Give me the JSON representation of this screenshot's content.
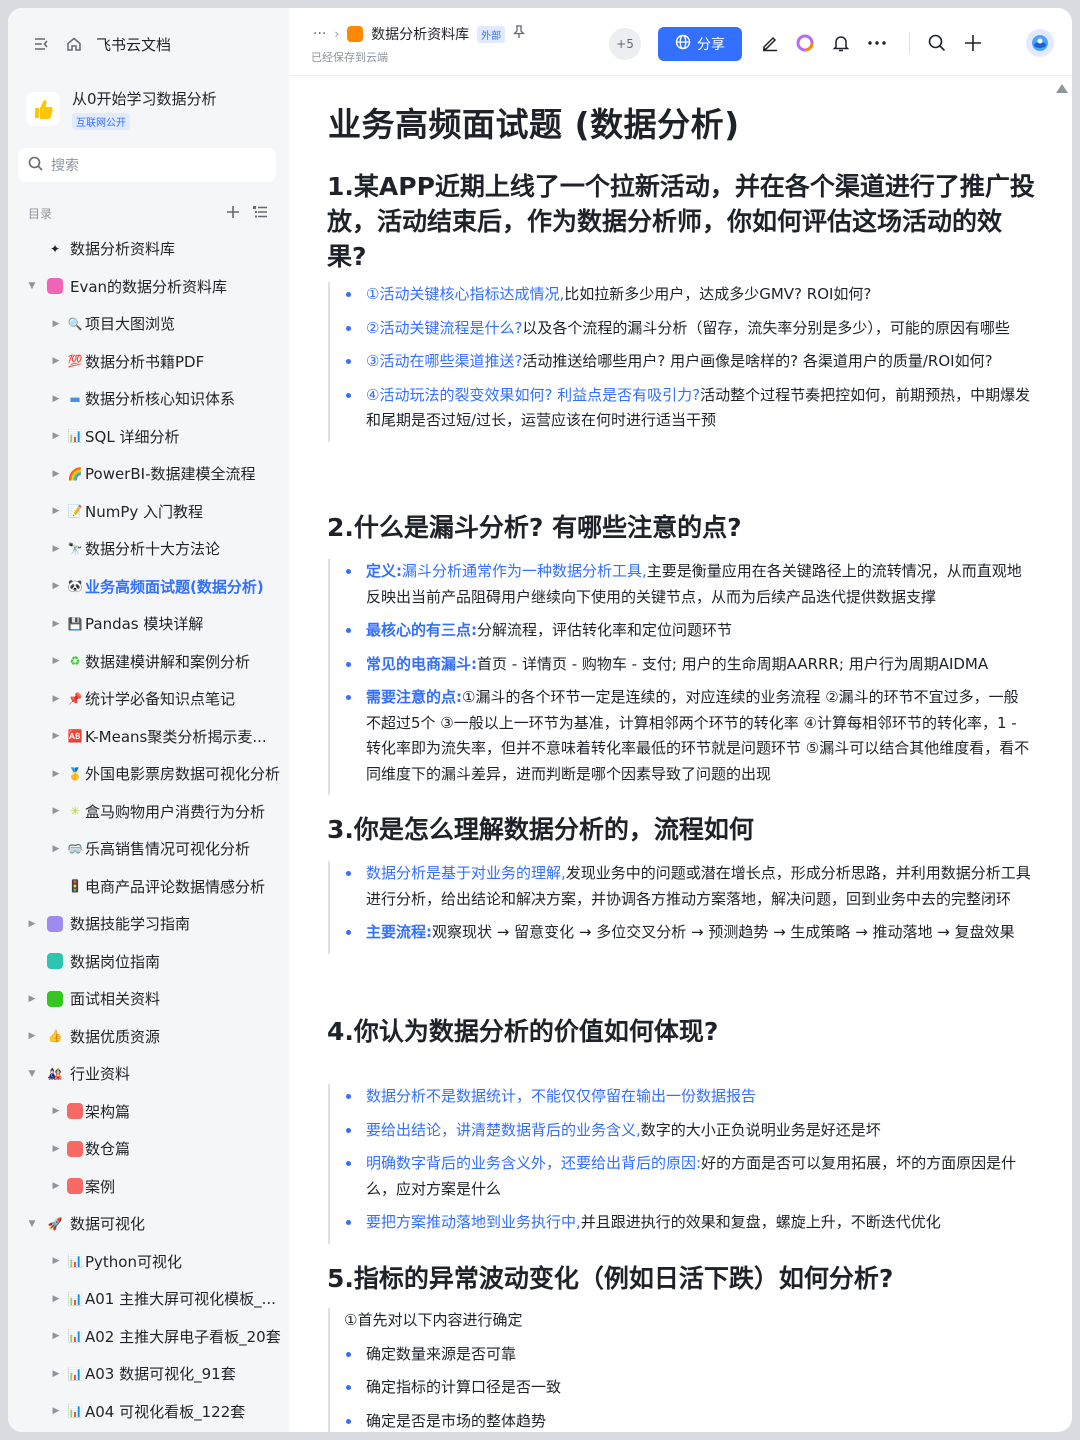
{
  "app": {
    "name": "飞书云文档"
  },
  "space": {
    "name": "从0开始学习数据分析",
    "badge": "互联网公开"
  },
  "search": {
    "placeholder": "搜索"
  },
  "toc": {
    "label": "目录"
  },
  "tree": [
    {
      "label": "数据分析资料库",
      "level": 0,
      "arrow": "",
      "icon": "✦",
      "iconColor": "#1f2329"
    },
    {
      "label": "Evan的数据分析资料库",
      "level": 0,
      "arrow": "▼",
      "icon": "sq",
      "iconColor": "#f065b8"
    },
    {
      "label": "项目大图浏览",
      "level": 1,
      "arrow": "▶",
      "icon": "🔍",
      "iconColor": "#3370ff"
    },
    {
      "label": "数据分析书籍PDF",
      "level": 1,
      "arrow": "▶",
      "icon": "💯",
      "iconColor": "#f54a45"
    },
    {
      "label": "数据分析核心知识体系",
      "level": 1,
      "arrow": "▶",
      "icon": "▬",
      "iconColor": "#4a90e2"
    },
    {
      "label": "SQL 详细分析",
      "level": 1,
      "arrow": "▶",
      "icon": "📊",
      "iconColor": "#3370ff"
    },
    {
      "label": "PowerBI-数据建模全流程",
      "level": 1,
      "arrow": "▶",
      "icon": "🌈",
      "iconColor": "#ff8800"
    },
    {
      "label": "NumPy 入门教程",
      "level": 1,
      "arrow": "▶",
      "icon": "📝",
      "iconColor": "#f54a45"
    },
    {
      "label": "数据分析十大方法论",
      "level": 1,
      "arrow": "▶",
      "icon": "🔭",
      "iconColor": "#5b6bd5"
    },
    {
      "label": "业务高频面试题(数据分析)",
      "level": 1,
      "arrow": "▶",
      "icon": "🐼",
      "iconColor": "#1f2329",
      "active": true
    },
    {
      "label": "Pandas 模块详解",
      "level": 1,
      "arrow": "▶",
      "icon": "💾",
      "iconColor": "#5b6bd5"
    },
    {
      "label": "数据建模讲解和案例分析",
      "level": 1,
      "arrow": "▶",
      "icon": "♻",
      "iconColor": "#34c724"
    },
    {
      "label": "统计学必备知识点笔记",
      "level": 1,
      "arrow": "▶",
      "icon": "📌",
      "iconColor": "#f54a45"
    },
    {
      "label": "K-Means聚类分析揭示麦...",
      "level": 1,
      "arrow": "▶",
      "icon": "🆎",
      "iconColor": "#f54a45"
    },
    {
      "label": "外国电影票房数据可视化分析",
      "level": 1,
      "arrow": "▶",
      "icon": "🥇",
      "iconColor": "#ffc60a"
    },
    {
      "label": "盒马购物用户消费行为分析",
      "level": 1,
      "arrow": "▶",
      "icon": "✳",
      "iconColor": "#b5d334"
    },
    {
      "label": "乐高销售情况可视化分析",
      "level": 1,
      "arrow": "▶",
      "icon": "🥽",
      "iconColor": "#5b6bd5"
    },
    {
      "label": "电商产品评论数据情感分析",
      "level": 1,
      "arrow": "",
      "icon": "🚦",
      "iconColor": "#34c724"
    },
    {
      "label": "数据技能学习指南",
      "level": 0,
      "arrow": "▶",
      "icon": "sq",
      "iconColor": "#9f8bf0"
    },
    {
      "label": "数据岗位指南",
      "level": 0,
      "arrow": "",
      "icon": "sq",
      "iconColor": "#2dc4b2"
    },
    {
      "label": "面试相关资料",
      "level": 0,
      "arrow": "▶",
      "icon": "sq",
      "iconColor": "#34c724"
    },
    {
      "label": "数据优质资源",
      "level": 0,
      "arrow": "▶",
      "icon": "👍",
      "iconColor": "#ffc60a"
    },
    {
      "label": "行业资料",
      "level": 0,
      "arrow": "▼",
      "icon": "🎎",
      "iconColor": "#f54a45"
    },
    {
      "label": "架构篇",
      "level": 1,
      "arrow": "▶",
      "icon": "sq",
      "iconColor": "#f76964"
    },
    {
      "label": "数仓篇",
      "level": 1,
      "arrow": "▶",
      "icon": "sq",
      "iconColor": "#f76964"
    },
    {
      "label": "案例",
      "level": 1,
      "arrow": "▶",
      "icon": "sq",
      "iconColor": "#f76964"
    },
    {
      "label": "数据可视化",
      "level": 0,
      "arrow": "▼",
      "icon": "🚀",
      "iconColor": "#f54a45"
    },
    {
      "label": "Python可视化",
      "level": 1,
      "arrow": "▶",
      "icon": "📊",
      "iconColor": "#3370ff"
    },
    {
      "label": "A01 主推大屏可视化模板_...",
      "level": 1,
      "arrow": "▶",
      "icon": "📊",
      "iconColor": "#3370ff"
    },
    {
      "label": "A02 主推大屏电子看板_20套",
      "level": 1,
      "arrow": "▶",
      "icon": "📊",
      "iconColor": "#3370ff"
    },
    {
      "label": "A03 数据可视化_91套",
      "level": 1,
      "arrow": "▶",
      "icon": "📊",
      "iconColor": "#3370ff"
    },
    {
      "label": "A04 可视化看板_122套",
      "level": 1,
      "arrow": "▶",
      "icon": "📊",
      "iconColor": "#3370ff"
    }
  ],
  "topbar": {
    "more": "···",
    "crumb": "数据分析资料库",
    "external": "外部",
    "saved": "已经保存到云端",
    "collaborators": "+5",
    "share_label": "分享"
  },
  "doc": {
    "title": "业务高频面试题 (数据分析)",
    "sections": [
      {
        "heading": "1.某APP近期上线了一个拉新活动，并在各个渠道进行了推广投放，活动结束后，作为数据分析师，你如何评估这场活动的效果?",
        "items": [
          {
            "hl": "①活动关键核心指标达成情况,",
            "text": "比如拉新多少用户，达成多少GMV? ROI如何?"
          },
          {
            "hl": "②活动关键流程是什么?",
            "text": "以及各个流程的漏斗分析（留存，流失率分别是多少），可能的原因有哪些"
          },
          {
            "hl": "③活动在哪些渠道推送?",
            "text": "活动推送给哪些用户? 用户画像是啥样的? 各渠道用户的质量/ROI如何?"
          },
          {
            "hl": "④活动玩法的裂变效果如何? 利益点是否有吸引力?",
            "text": "活动整个过程节奏把控如何，前期预热，中期爆发和尾期是否过短/过长，运营应该在何时进行适当干预"
          }
        ]
      },
      {
        "heading": "2.什么是漏斗分析? 有哪些注意的点?",
        "items": [
          {
            "hlb": "定义:",
            "hl": "漏斗分析通常作为一种数据分析工具,",
            "text": "主要是衡量应用在各关键路径上的流转情况，从而直观地反映出当前产品阻碍用户继续向下使用的关键节点，从而为后续产品迭代提供数据支撑"
          },
          {
            "hlb": "最核心的有三点:",
            "text": "分解流程，评估转化率和定位问题环节"
          },
          {
            "hlb": "常见的电商漏斗:",
            "text": "首页 - 详情页 - 购物车 - 支付; 用户的生命周期AARRR; 用户行为周期AIDMA"
          },
          {
            "hlb": "需要注意的点:",
            "text": "①漏斗的各个环节一定是连续的，对应连续的业务流程 ②漏斗的环节不宜过多，一般不超过5个 ③一般以上一环节为基准，计算相邻两个环节的转化率 ④计算每相邻环节的转化率，1 - 转化率即为流失率，但并不意味着转化率最低的环节就是问题环节 ⑤漏斗可以结合其他维度看，看不同维度下的漏斗差异，进而判断是哪个因素导致了问题的出现"
          }
        ]
      },
      {
        "heading": "3.你是怎么理解数据分析的，流程如何",
        "items": [
          {
            "hl": "数据分析是基于对业务的理解,",
            "text": "发现业务中的问题或潜在增长点，形成分析思路，并利用数据分析工具进行分析，给出结论和解决方案，并协调各方推动方案落地，解决问题，回到业务中去的完整闭环"
          },
          {
            "hlb": "主要流程:",
            "text": "观察现状 → 留意变化 → 多位交叉分析 → 预测趋势 → 生成策略 → 推动落地 → 复盘效果"
          }
        ]
      },
      {
        "heading": "4.你认为数据分析的价值如何体现?",
        "items": [
          {
            "hl": "数据分析不是数据统计，不能仅仅停留在输出一份数据报告",
            "text": ""
          },
          {
            "hl": "要给出结论，讲清楚数据背后的业务含义,",
            "text": "数字的大小正负说明业务是好还是坏"
          },
          {
            "hl": "明确数字背后的业务含义外，还要给出背后的原因:",
            "text": "好的方面是否可以复用拓展，坏的方面原因是什么，应对方案是什么"
          },
          {
            "hl": "要把方案推动落地到业务执行中,",
            "text": "并且跟进执行的效果和复盘，螺旋上升，不断迭代优化"
          }
        ]
      },
      {
        "heading": "5.指标的异常波动变化（例如日活下跌）如何分析?",
        "intro": "①首先对以下内容进行确定",
        "items": [
          {
            "text": "确定数量来源是否可靠"
          },
          {
            "text": "确定指标的计算口径是否一致"
          },
          {
            "text": "确定是否是市场的整体趋势"
          }
        ]
      }
    ]
  }
}
